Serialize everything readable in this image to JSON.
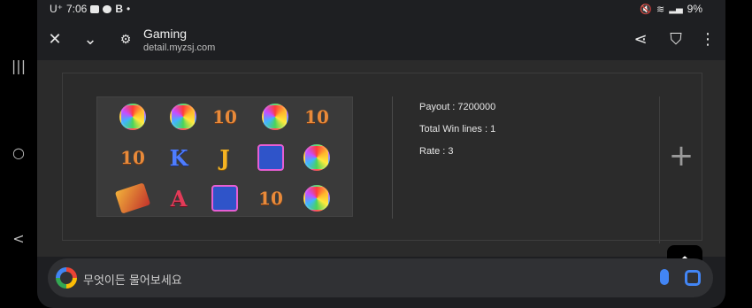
{
  "status_bar": {
    "carrier": "U⁺",
    "time": "7:06",
    "battery": "9%"
  },
  "toolbar": {
    "title": "Gaming",
    "url": "detail.myzsj.com"
  },
  "game": {
    "reels": [
      [
        "lollipop",
        "lollipop",
        "10",
        "lollipop",
        "10"
      ],
      [
        "10",
        "K",
        "J",
        "gem",
        "lollipop"
      ],
      [
        "chocolate",
        "A",
        "gem",
        "10",
        "lollipop"
      ]
    ],
    "payout_label": "Payout : 7200000",
    "win_lines_label": "Total Win lines : 1",
    "rate_label": "Rate : 3"
  },
  "search": {
    "placeholder": "무엇이든 물어보세요"
  },
  "nav": {
    "recent": "|||",
    "home": "○",
    "back": "<"
  }
}
